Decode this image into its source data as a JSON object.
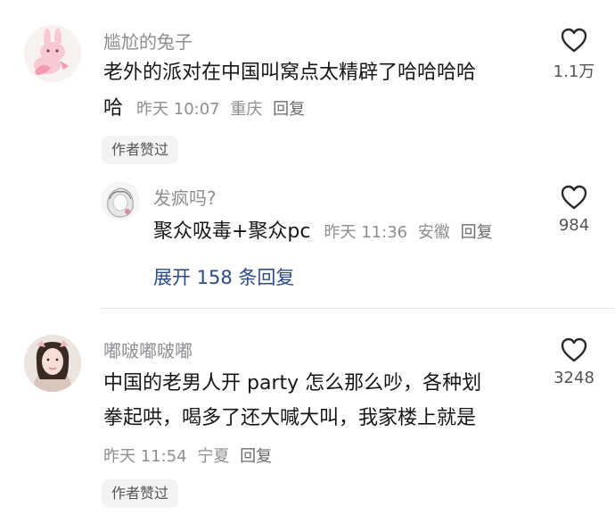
{
  "comments": [
    {
      "author": "尴尬的兔子",
      "line1": "老外的派对在中国叫窝点太精辟了哈哈哈哈",
      "line2_text": "哈",
      "time": "昨天 10:07",
      "location": "重庆",
      "reply": "回复",
      "likes": "1.1万",
      "badge": "作者赞过",
      "avatar_icon": "pink-bunny-avatar-icon"
    },
    {
      "author": "发疯吗?",
      "line1": "聚众吸毒+聚众pc",
      "time": "昨天 11:36",
      "location": "安徽",
      "reply": "回复",
      "likes": "984",
      "avatar_icon": "sketch-girl-avatar-icon"
    },
    {
      "author": "嘟啵嘟啵嘟",
      "line1": "中国的老男人开 party 怎么那么吵，各种划",
      "line2": "拳起哄，喝多了还大喊大叫，我家楼上就是",
      "time": "昨天 11:54",
      "location": "宁夏",
      "reply": "回复",
      "likes": "3248",
      "badge": "作者赞过",
      "avatar_icon": "photo-avatar-icon"
    }
  ],
  "expand_replies": "展开 158 条回复",
  "colors": {
    "meta_gray": "#8e8e93",
    "link_blue": "#2b4b83",
    "badge_bg": "#f3f3f3"
  }
}
